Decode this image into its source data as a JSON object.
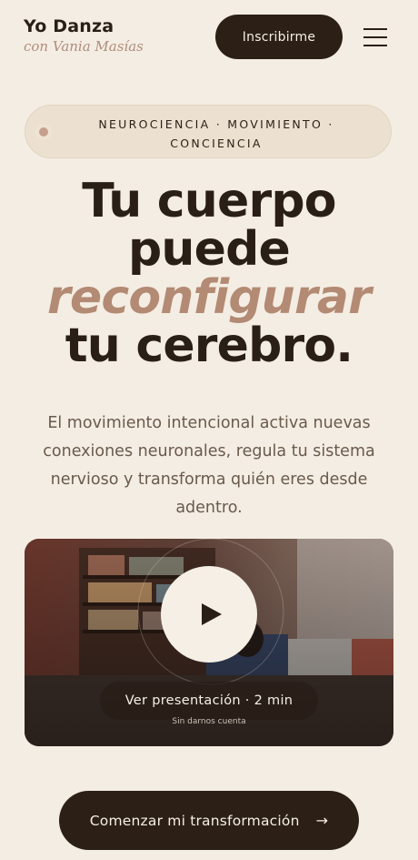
{
  "brand": {
    "title": "Yo Danza",
    "subtitle": "con Vania Masías"
  },
  "header": {
    "signup_label": "Inscribirme",
    "menu_icon": "hamburger-menu-icon"
  },
  "tagline": {
    "line1": "NEUROCIENCIA · MOVIMIENTO ·",
    "line2": "CONCIENCIA"
  },
  "hero": {
    "line1": "Tu cuerpo",
    "line2": "puede",
    "line3": "reconfigurar",
    "line4": "tu cerebro."
  },
  "lead": "El movimiento intencional activa nuevas conexiones neuronales, regula tu sistema nervioso y transforma quién eres desde adentro.",
  "video": {
    "button_label": "Ver presentación · 2 min",
    "note": "Sin darnos cuenta"
  },
  "cta": {
    "label": "Comenzar mi transformación",
    "arrow": "→"
  },
  "colors": {
    "background": "#f4ede3",
    "dark": "#2b1f16",
    "accent": "#b38a73"
  }
}
